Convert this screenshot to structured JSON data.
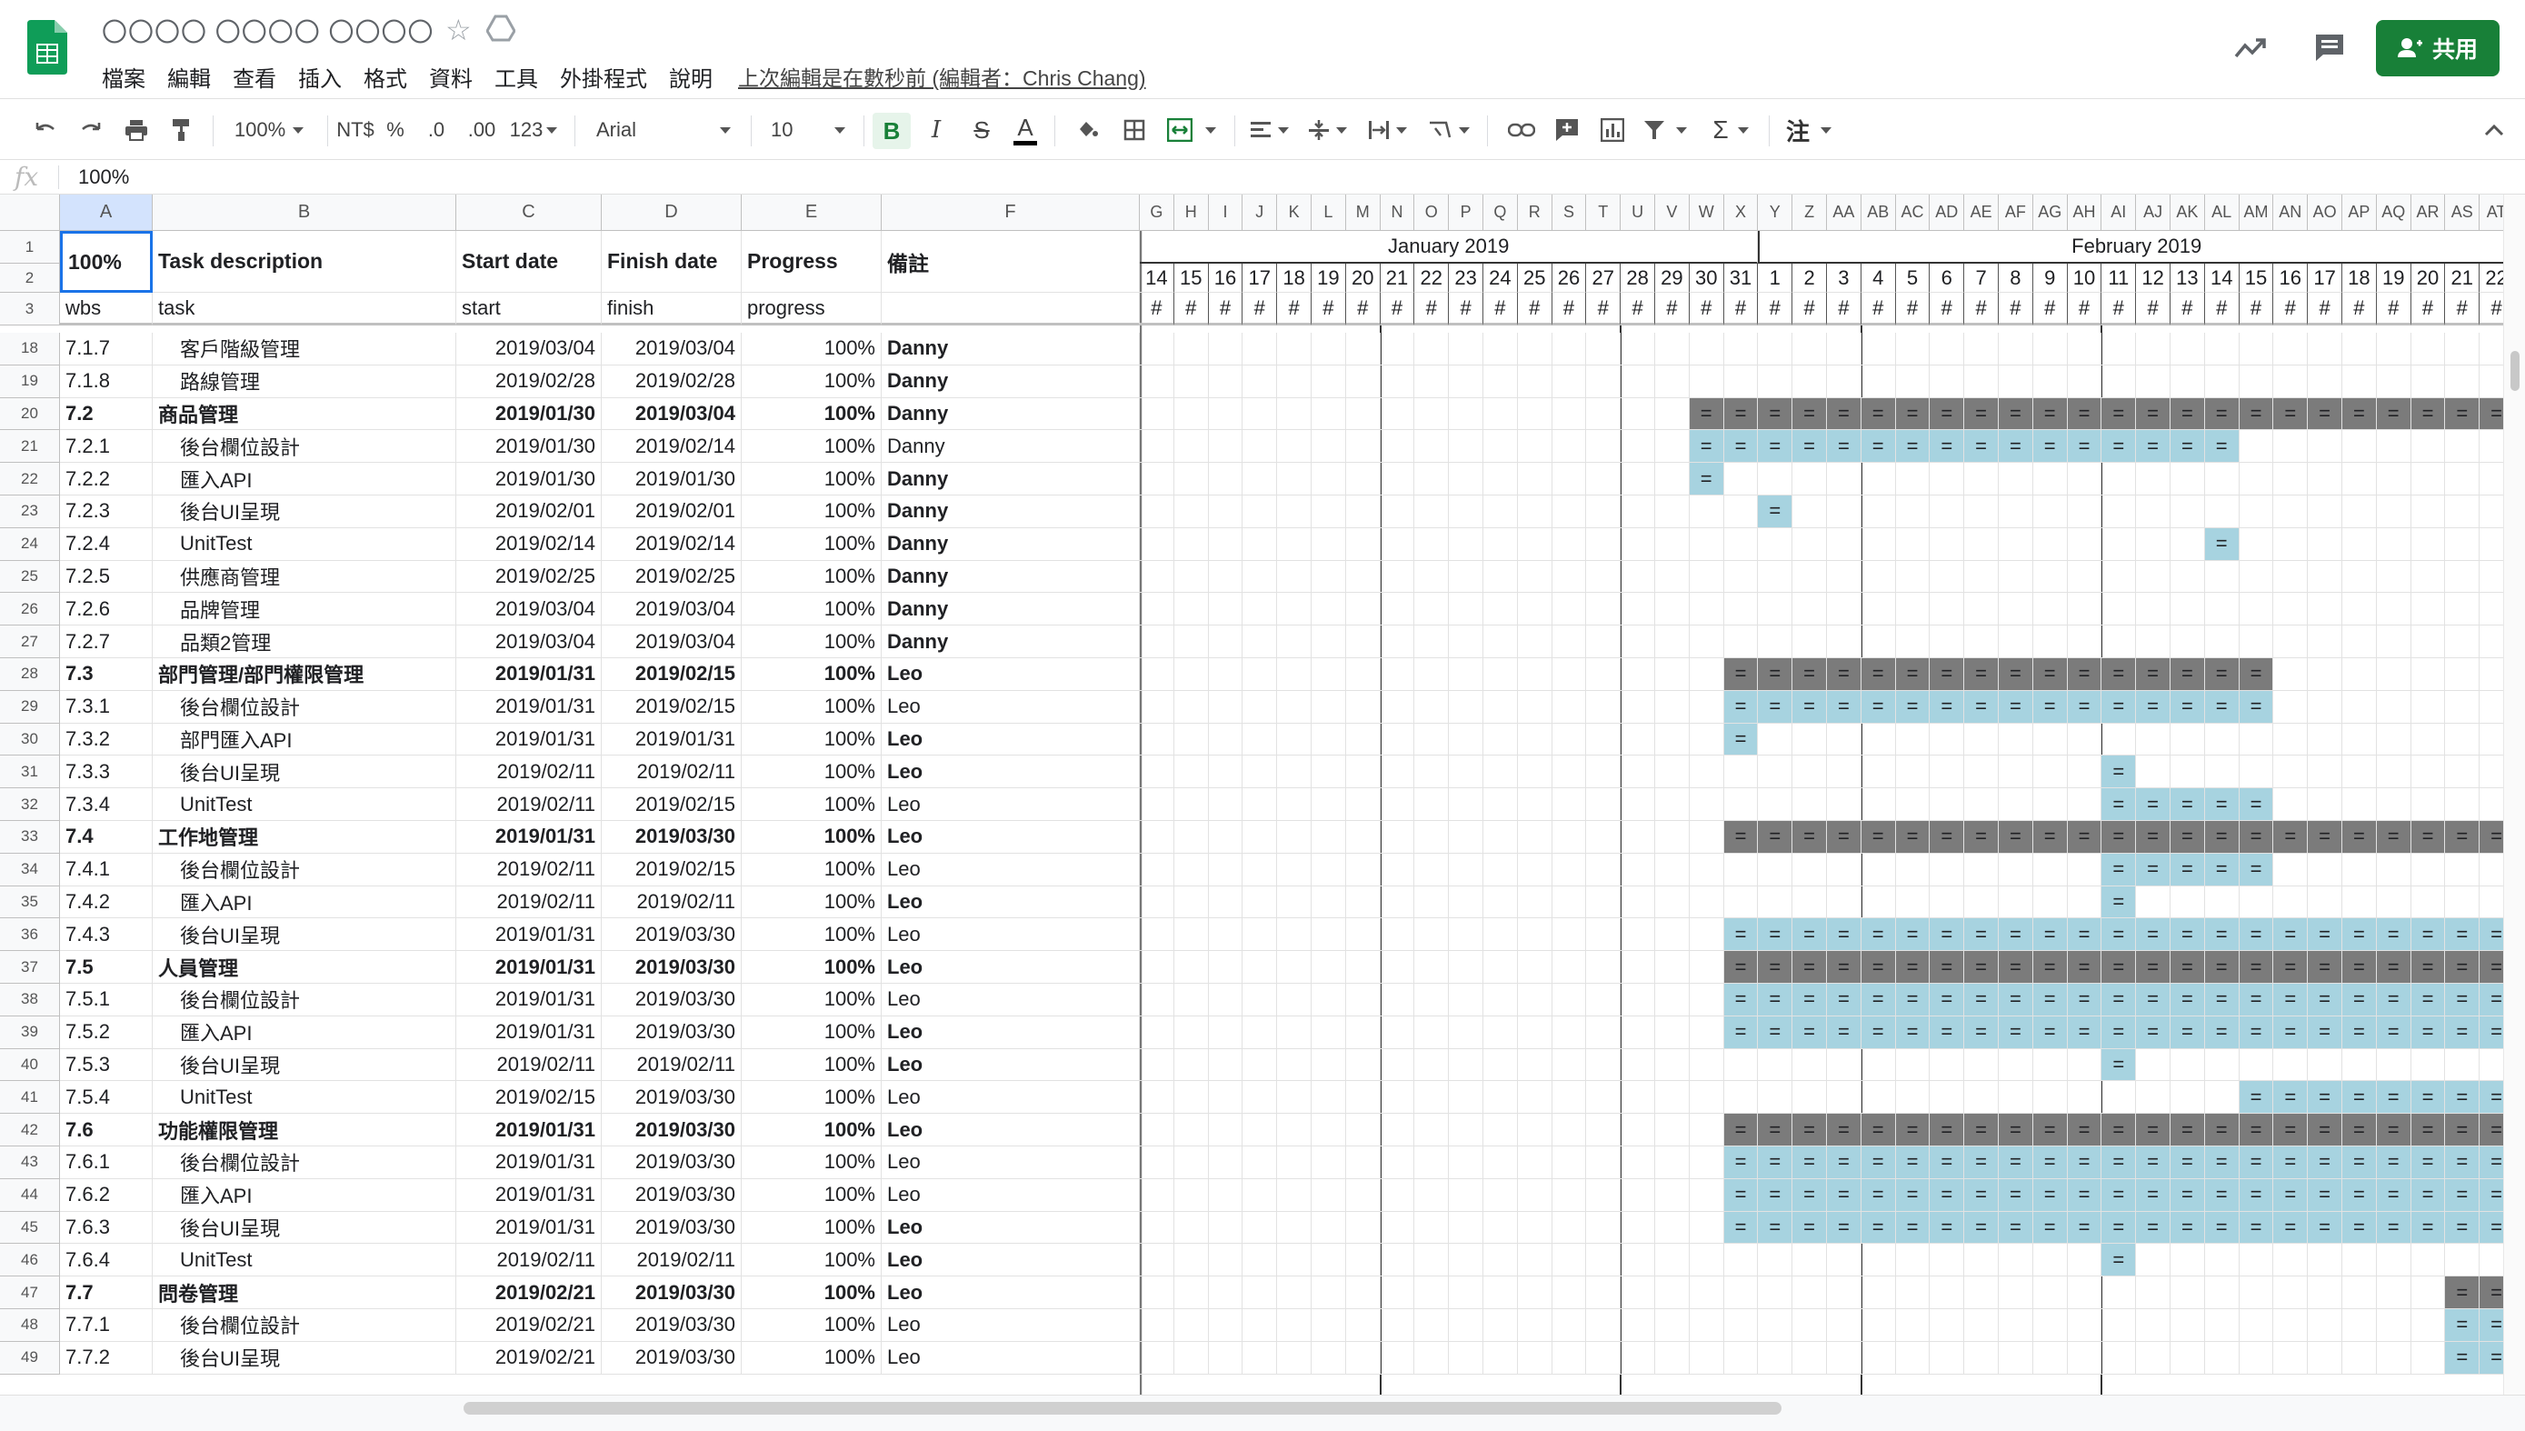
{
  "app": {
    "doc_title": "〇〇〇〇 〇〇〇〇 〇〇〇〇",
    "menu": [
      "檔案",
      "編輯",
      "查看",
      "插入",
      "格式",
      "資料",
      "工具",
      "外掛程式",
      "說明"
    ],
    "last_edit": "上次編輯是在數秒前 (編輯者：Chris Chang)",
    "share_label": "共用"
  },
  "colors": {
    "share": "#188038",
    "bar_dark": "#7b7b7b",
    "bar_light": "#a7d3e0",
    "sheets_green": "#0f9d58"
  },
  "toolbar": {
    "zoom": "100%",
    "currency": "NT$",
    "percent": "%",
    "decimal_less": ".0",
    "decimal_more": ".00",
    "more_formats": "123",
    "font": "Arial",
    "font_size": "10",
    "bold": "B",
    "italic": "I",
    "strike": "S",
    "text_color": "A",
    "annotate": "注",
    "sum": "Σ"
  },
  "formula": {
    "fx": "fx",
    "value": "100%"
  },
  "columns": {
    "left": [
      "A",
      "B",
      "C",
      "D",
      "E",
      "F"
    ],
    "gantt": [
      "G",
      "H",
      "I",
      "J",
      "K",
      "L",
      "M",
      "N",
      "O",
      "P",
      "Q",
      "R",
      "S",
      "T",
      "U",
      "V",
      "W",
      "X",
      "Y",
      "Z",
      "AA",
      "AB",
      "AC",
      "AD",
      "AE",
      "AF",
      "AG",
      "AH",
      "AI",
      "AJ",
      "AK",
      "AL",
      "AM",
      "AN",
      "AO",
      "AP",
      "AQ",
      "AR",
      "AS",
      "AT"
    ]
  },
  "header": {
    "row_numbers": [
      "1",
      "2",
      "3"
    ],
    "r1": [
      "100%",
      "Task description",
      "Start date",
      "Finish date",
      "Progress",
      "備註"
    ],
    "r3": [
      "wbs",
      "task",
      "start",
      "finish",
      "progress",
      ""
    ],
    "months": [
      "January 2019",
      "February 2019"
    ],
    "days": [
      "14",
      "15",
      "16",
      "17",
      "18",
      "19",
      "20",
      "21",
      "22",
      "23",
      "24",
      "25",
      "26",
      "27",
      "28",
      "29",
      "30",
      "31",
      "1",
      "2",
      "3",
      "4",
      "5",
      "6",
      "7",
      "8",
      "9",
      "10",
      "11",
      "12",
      "13",
      "14",
      "15",
      "16",
      "17",
      "18",
      "19",
      "20",
      "21",
      "22"
    ],
    "hash": "#",
    "bar_mark": "="
  },
  "rows": [
    {
      "n": "18",
      "wbs": "7.1.7",
      "task": "客戶階級管理",
      "start": "2019/03/04",
      "finish": "2019/03/04",
      "progress": "100%",
      "note": "Danny",
      "bold": false,
      "nb": true,
      "bars": []
    },
    {
      "n": "19",
      "wbs": "7.1.8",
      "task": "路線管理",
      "start": "2019/02/28",
      "finish": "2019/02/28",
      "progress": "100%",
      "note": "Danny",
      "bold": false,
      "nb": true,
      "bars": []
    },
    {
      "n": "20",
      "wbs": "7.2",
      "task": "商品管理",
      "start": "2019/01/30",
      "finish": "2019/03/04",
      "progress": "100%",
      "note": "Danny",
      "bold": true,
      "nb": true,
      "bars": [
        [
          16,
          39,
          "d"
        ]
      ]
    },
    {
      "n": "21",
      "wbs": "7.2.1",
      "task": "後台欄位設計",
      "start": "2019/01/30",
      "finish": "2019/02/14",
      "progress": "100%",
      "note": "Danny",
      "bold": false,
      "nb": false,
      "bars": [
        [
          16,
          31,
          "l"
        ]
      ]
    },
    {
      "n": "22",
      "wbs": "7.2.2",
      "task": "匯入API",
      "start": "2019/01/30",
      "finish": "2019/01/30",
      "progress": "100%",
      "note": "Danny",
      "bold": false,
      "nb": true,
      "bars": [
        [
          16,
          16,
          "l"
        ]
      ]
    },
    {
      "n": "23",
      "wbs": "7.2.3",
      "task": "後台UI呈現",
      "start": "2019/02/01",
      "finish": "2019/02/01",
      "progress": "100%",
      "note": "Danny",
      "bold": false,
      "nb": true,
      "bars": [
        [
          18,
          18,
          "l"
        ]
      ]
    },
    {
      "n": "24",
      "wbs": "7.2.4",
      "task": "UnitTest",
      "start": "2019/02/14",
      "finish": "2019/02/14",
      "progress": "100%",
      "note": "Danny",
      "bold": false,
      "nb": true,
      "bars": [
        [
          31,
          31,
          "l"
        ]
      ]
    },
    {
      "n": "25",
      "wbs": "7.2.5",
      "task": "供應商管理",
      "start": "2019/02/25",
      "finish": "2019/02/25",
      "progress": "100%",
      "note": "Danny",
      "bold": false,
      "nb": true,
      "bars": []
    },
    {
      "n": "26",
      "wbs": "7.2.6",
      "task": "品牌管理",
      "start": "2019/03/04",
      "finish": "2019/03/04",
      "progress": "100%",
      "note": "Danny",
      "bold": false,
      "nb": true,
      "bars": []
    },
    {
      "n": "27",
      "wbs": "7.2.7",
      "task": "品類2管理",
      "start": "2019/03/04",
      "finish": "2019/03/04",
      "progress": "100%",
      "note": "Danny",
      "bold": false,
      "nb": true,
      "bars": []
    },
    {
      "n": "28",
      "wbs": "7.3",
      "task": "部門管理/部門權限管理",
      "start": "2019/01/31",
      "finish": "2019/02/15",
      "progress": "100%",
      "note": "Leo",
      "bold": true,
      "nb": true,
      "bars": [
        [
          17,
          32,
          "d"
        ]
      ]
    },
    {
      "n": "29",
      "wbs": "7.3.1",
      "task": "後台欄位設計",
      "start": "2019/01/31",
      "finish": "2019/02/15",
      "progress": "100%",
      "note": "Leo",
      "bold": false,
      "nb": false,
      "bars": [
        [
          17,
          32,
          "l"
        ]
      ]
    },
    {
      "n": "30",
      "wbs": "7.3.2",
      "task": "部門匯入API",
      "start": "2019/01/31",
      "finish": "2019/01/31",
      "progress": "100%",
      "note": "Leo",
      "bold": false,
      "nb": true,
      "bars": [
        [
          17,
          17,
          "l"
        ]
      ]
    },
    {
      "n": "31",
      "wbs": "7.3.3",
      "task": "後台UI呈現",
      "start": "2019/02/11",
      "finish": "2019/02/11",
      "progress": "100%",
      "note": "Leo",
      "bold": false,
      "nb": true,
      "bars": [
        [
          28,
          28,
          "l"
        ]
      ]
    },
    {
      "n": "32",
      "wbs": "7.3.4",
      "task": "UnitTest",
      "start": "2019/02/11",
      "finish": "2019/02/15",
      "progress": "100%",
      "note": "Leo",
      "bold": false,
      "nb": false,
      "bars": [
        [
          28,
          32,
          "l"
        ]
      ]
    },
    {
      "n": "33",
      "wbs": "7.4",
      "task": "工作地管理",
      "start": "2019/01/31",
      "finish": "2019/03/30",
      "progress": "100%",
      "note": "Leo",
      "bold": true,
      "nb": true,
      "bars": [
        [
          17,
          39,
          "d"
        ]
      ]
    },
    {
      "n": "34",
      "wbs": "7.4.1",
      "task": "後台欄位設計",
      "start": "2019/02/11",
      "finish": "2019/02/15",
      "progress": "100%",
      "note": "Leo",
      "bold": false,
      "nb": false,
      "bars": [
        [
          28,
          32,
          "l"
        ]
      ]
    },
    {
      "n": "35",
      "wbs": "7.4.2",
      "task": "匯入API",
      "start": "2019/02/11",
      "finish": "2019/02/11",
      "progress": "100%",
      "note": "Leo",
      "bold": false,
      "nb": true,
      "bars": [
        [
          28,
          28,
          "l"
        ]
      ]
    },
    {
      "n": "36",
      "wbs": "7.4.3",
      "task": "後台UI呈現",
      "start": "2019/01/31",
      "finish": "2019/03/30",
      "progress": "100%",
      "note": "Leo",
      "bold": false,
      "nb": false,
      "bars": [
        [
          17,
          39,
          "l"
        ]
      ]
    },
    {
      "n": "37",
      "wbs": "7.5",
      "task": "人員管理",
      "start": "2019/01/31",
      "finish": "2019/03/30",
      "progress": "100%",
      "note": "Leo",
      "bold": true,
      "nb": true,
      "bars": [
        [
          17,
          39,
          "d"
        ]
      ]
    },
    {
      "n": "38",
      "wbs": "7.5.1",
      "task": "後台欄位設計",
      "start": "2019/01/31",
      "finish": "2019/03/30",
      "progress": "100%",
      "note": "Leo",
      "bold": false,
      "nb": false,
      "bars": [
        [
          17,
          39,
          "l"
        ]
      ]
    },
    {
      "n": "39",
      "wbs": "7.5.2",
      "task": "匯入API",
      "start": "2019/01/31",
      "finish": "2019/03/30",
      "progress": "100%",
      "note": "Leo",
      "bold": false,
      "nb": true,
      "bars": [
        [
          17,
          39,
          "l"
        ]
      ]
    },
    {
      "n": "40",
      "wbs": "7.5.3",
      "task": "後台UI呈現",
      "start": "2019/02/11",
      "finish": "2019/02/11",
      "progress": "100%",
      "note": "Leo",
      "bold": false,
      "nb": true,
      "bars": [
        [
          28,
          28,
          "l"
        ]
      ]
    },
    {
      "n": "41",
      "wbs": "7.5.4",
      "task": "UnitTest",
      "start": "2019/02/15",
      "finish": "2019/03/30",
      "progress": "100%",
      "note": "Leo",
      "bold": false,
      "nb": false,
      "bars": [
        [
          32,
          39,
          "l"
        ]
      ]
    },
    {
      "n": "42",
      "wbs": "7.6",
      "task": "功能權限管理",
      "start": "2019/01/31",
      "finish": "2019/03/30",
      "progress": "100%",
      "note": "Leo",
      "bold": true,
      "nb": true,
      "bars": [
        [
          17,
          39,
          "d"
        ]
      ]
    },
    {
      "n": "43",
      "wbs": "7.6.1",
      "task": "後台欄位設計",
      "start": "2019/01/31",
      "finish": "2019/03/30",
      "progress": "100%",
      "note": "Leo",
      "bold": false,
      "nb": false,
      "bars": [
        [
          17,
          39,
          "l"
        ]
      ]
    },
    {
      "n": "44",
      "wbs": "7.6.2",
      "task": "匯入API",
      "start": "2019/01/31",
      "finish": "2019/03/30",
      "progress": "100%",
      "note": "Leo",
      "bold": false,
      "nb": false,
      "bars": [
        [
          17,
          39,
          "l"
        ]
      ]
    },
    {
      "n": "45",
      "wbs": "7.6.3",
      "task": "後台UI呈現",
      "start": "2019/01/31",
      "finish": "2019/03/30",
      "progress": "100%",
      "note": "Leo",
      "bold": false,
      "nb": true,
      "bars": [
        [
          17,
          39,
          "l"
        ]
      ]
    },
    {
      "n": "46",
      "wbs": "7.6.4",
      "task": "UnitTest",
      "start": "2019/02/11",
      "finish": "2019/02/11",
      "progress": "100%",
      "note": "Leo",
      "bold": false,
      "nb": true,
      "bars": [
        [
          28,
          28,
          "l"
        ]
      ]
    },
    {
      "n": "47",
      "wbs": "7.7",
      "task": "問卷管理",
      "start": "2019/02/21",
      "finish": "2019/03/30",
      "progress": "100%",
      "note": "Leo",
      "bold": true,
      "nb": true,
      "bars": [
        [
          38,
          39,
          "d"
        ]
      ]
    },
    {
      "n": "48",
      "wbs": "7.7.1",
      "task": "後台欄位設計",
      "start": "2019/02/21",
      "finish": "2019/03/30",
      "progress": "100%",
      "note": "Leo",
      "bold": false,
      "nb": false,
      "bars": [
        [
          38,
          39,
          "l"
        ]
      ]
    },
    {
      "n": "49",
      "wbs": "7.7.2",
      "task": "後台UI呈現",
      "start": "2019/02/21",
      "finish": "2019/03/30",
      "progress": "100%",
      "note": "Leo",
      "bold": false,
      "nb": false,
      "bars": [
        [
          38,
          39,
          "l"
        ]
      ]
    }
  ]
}
